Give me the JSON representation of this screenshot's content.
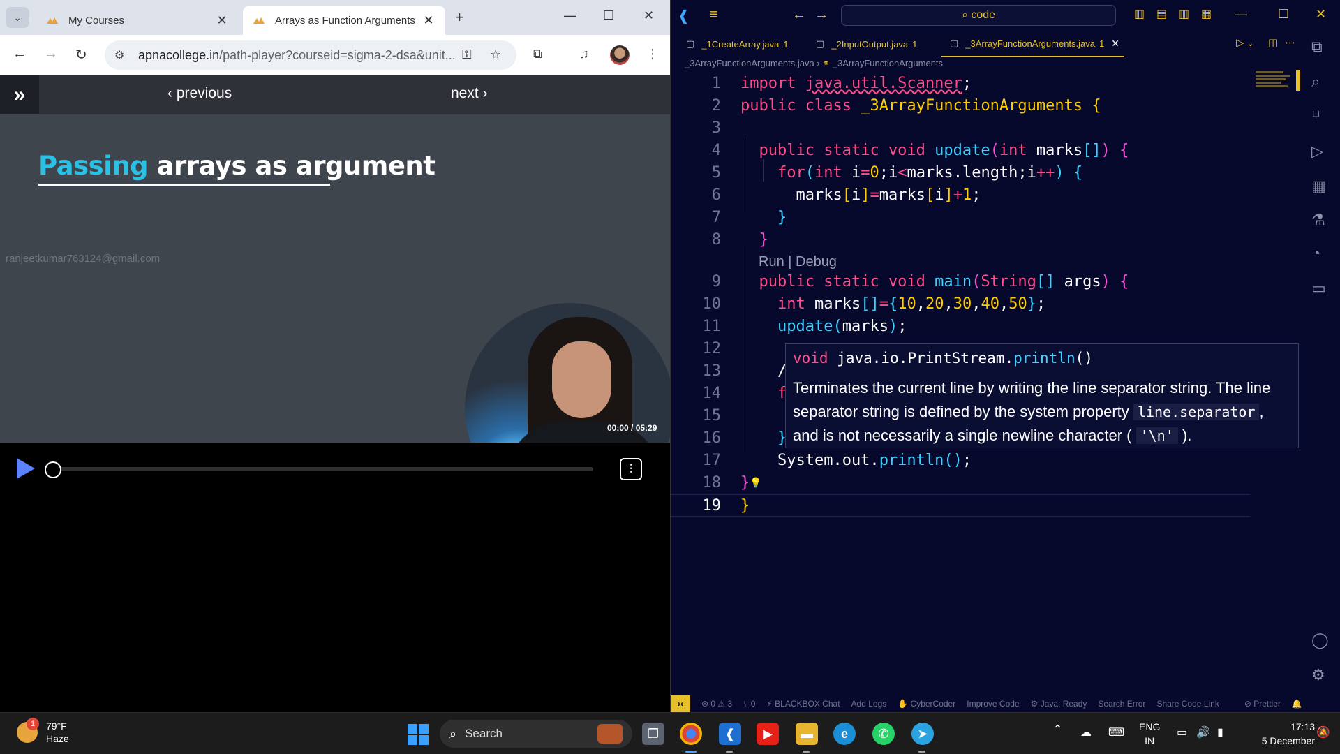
{
  "browser": {
    "tabs": [
      {
        "title": "My Courses"
      },
      {
        "title": "Arrays as Function Arguments"
      }
    ],
    "url_domain": "apnacollege.in",
    "url_path": "/path-player?courseid=sigma-2-dsa&unit..."
  },
  "player": {
    "previous_label": "previous",
    "next_label": "next",
    "slide_title_highlight": "Passing",
    "slide_title_rest": " arrays as argument",
    "watermark": "ranjeetkumar763124@gmail.com",
    "timecode": "00:00 / 05:29",
    "progress": 0
  },
  "vscode": {
    "command_center": "code",
    "tabs": [
      {
        "name": "_1CreateArray.java",
        "count": "1"
      },
      {
        "name": "_2InputOutput.java",
        "count": "1"
      },
      {
        "name": "_3ArrayFunctionArguments.java",
        "count": "1"
      }
    ],
    "breadcrumb_file": "_3ArrayFunctionArguments.java",
    "breadcrumb_symbol": "_3ArrayFunctionArguments",
    "codelens": "Run | Debug",
    "line_numbers": [
      "1",
      "2",
      "3",
      "4",
      "5",
      "6",
      "7",
      "8",
      "9",
      "10",
      "11",
      "12",
      "13",
      "14",
      "15",
      "16",
      "17",
      "18",
      "19"
    ],
    "hover": {
      "sig_kw": "void",
      "sig_qual": " java.io.PrintStream.",
      "sig_fn": "println",
      "sig_end": "()",
      "doc_1": "Terminates the current line by writing the line separator string. The line separator string is defined by the system property ",
      "doc_code1": "line.separator",
      "doc_2": ", and is not necessarily a single newline character ( ",
      "doc_code2": "'\\n'",
      "doc_3": " )."
    },
    "status": {
      "problems": "⊗ 0 ⚠ 3",
      "ports": "⑂ 0",
      "blackbox": "BLACKBOX Chat",
      "addlogs": "Add Logs",
      "cybercoder": "CyberCoder",
      "improve": "Improve Code",
      "java": "Java: Ready",
      "searcherr": "Search Error",
      "share": "Share Code Link",
      "prettier": "Prettier"
    }
  },
  "taskbar": {
    "weather_temp": "79°F",
    "weather_cond": "Haze",
    "weather_badge": "1",
    "search_label": "Search",
    "lang_1": "ENG",
    "lang_2": "IN",
    "time": "17:13",
    "date": "5 December"
  },
  "colors": {
    "accent": "#e7c12b",
    "keyword": "#ff4f8b",
    "function": "#3fd2ff",
    "editor_bg": "#06092c"
  }
}
